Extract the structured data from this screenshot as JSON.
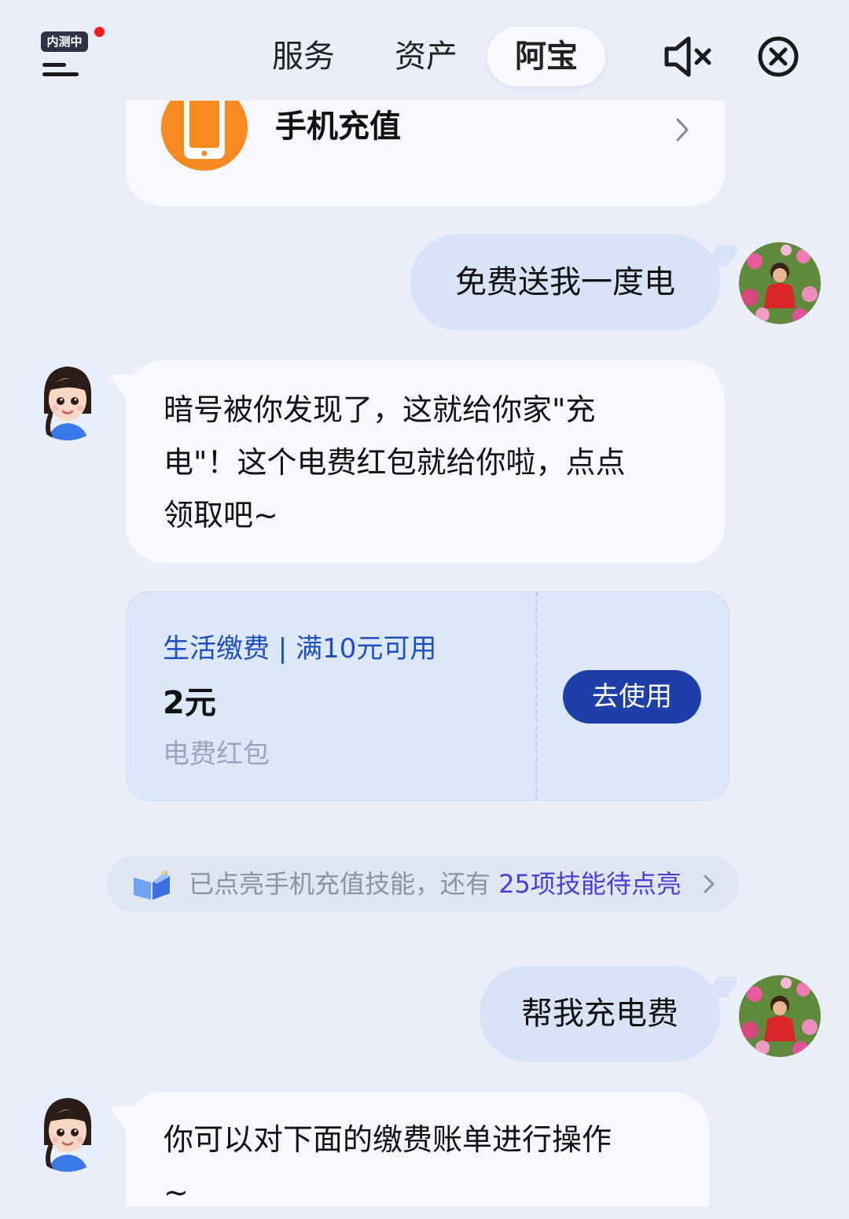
{
  "header": {
    "beta_badge": "内测中",
    "tabs": [
      {
        "label": "服务",
        "active": false
      },
      {
        "label": "资产",
        "active": false
      },
      {
        "label": "阿宝",
        "active": true
      }
    ],
    "mute_icon": "speaker-muted-icon",
    "close_icon": "circle-close-icon"
  },
  "service_card": {
    "icon": "phone-icon",
    "title": "手机充值",
    "chevron_icon": "chevron-right-icon"
  },
  "messages": [
    {
      "sender": "user",
      "text": "免费送我一度电"
    },
    {
      "sender": "bot",
      "lines": [
        "暗号被你发现了，这就给你家\"充",
        "电\"！这个电费红包就给你啦，点点",
        "领取吧~"
      ]
    },
    {
      "sender": "user",
      "text": "帮我充电费"
    },
    {
      "sender": "bot",
      "lines": [
        "你可以对下面的缴费账单进行操作",
        "~"
      ]
    }
  ],
  "coupon": {
    "scope": "生活缴费 | 满10元可用",
    "amount": "2元",
    "name": "电费红包",
    "button_label": "去使用"
  },
  "skill_notice": {
    "icon": "book-icon",
    "prefix": "已点亮手机充值技能，还有",
    "highlight": "25项技能待点亮",
    "chevron_icon": "chevron-right-icon"
  },
  "colors": {
    "background": "#e9eef8",
    "card": "#f7f9fe",
    "user_bubble": "#d9e3f8",
    "coupon_bg": "#dde7fa",
    "coupon_text": "#1e4fc2",
    "button": "#1e3fa8",
    "skill_highlight": "#4b3dd6",
    "phone_icon": "#f6891f"
  }
}
